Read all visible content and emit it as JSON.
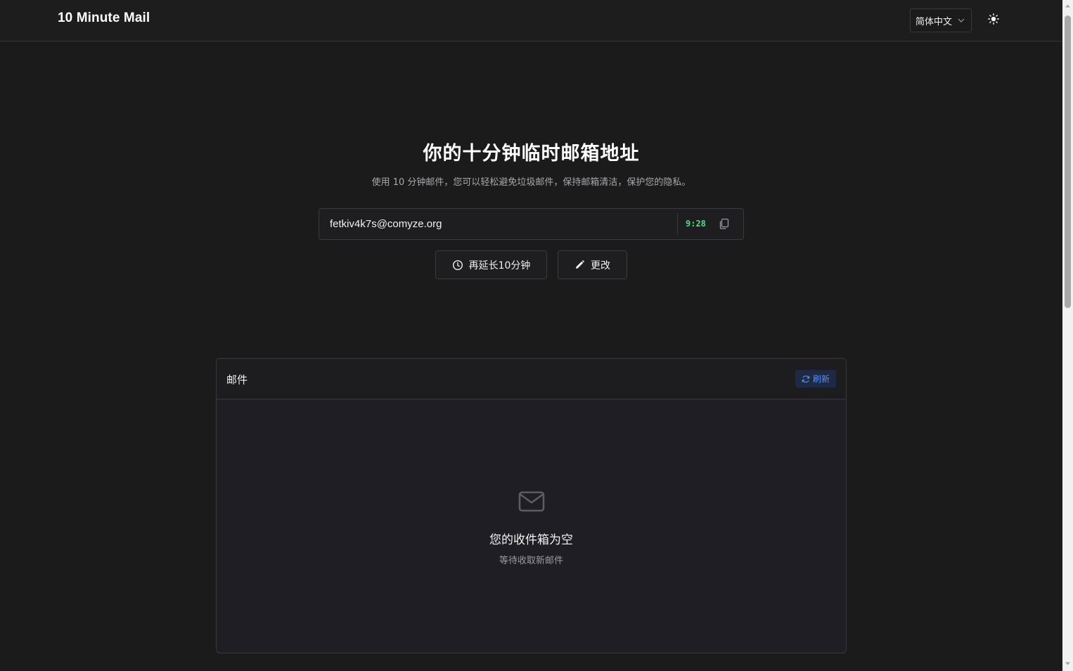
{
  "header": {
    "brand": "10 Minute Mail",
    "language": "简体中文",
    "language_icon": "chevron-down-icon",
    "theme_icon": "sun-icon"
  },
  "hero": {
    "title": "你的十分钟临时邮箱地址",
    "subtitle": "使用 10 分钟邮件，您可以轻松避免垃圾邮件，保持邮箱清洁，保护您的隐私。"
  },
  "email": {
    "address": "fetkiv4k7s@comyze.org",
    "timer": "9:28",
    "copy_icon": "copy-icon"
  },
  "actions": {
    "extend_label": "再延长10分钟",
    "extend_icon": "clock-icon",
    "change_label": "更改",
    "change_icon": "pencil-icon"
  },
  "inbox": {
    "title": "邮件",
    "refresh_label": "刷新",
    "refresh_icon": "refresh-icon",
    "empty_icon": "envelope-icon",
    "empty_title": "您的收件箱为空",
    "empty_subtitle": "等待收取新邮件"
  },
  "colors": {
    "background": "#1b1b1c",
    "timer": "#4ade80",
    "accent": "#5b8def"
  }
}
